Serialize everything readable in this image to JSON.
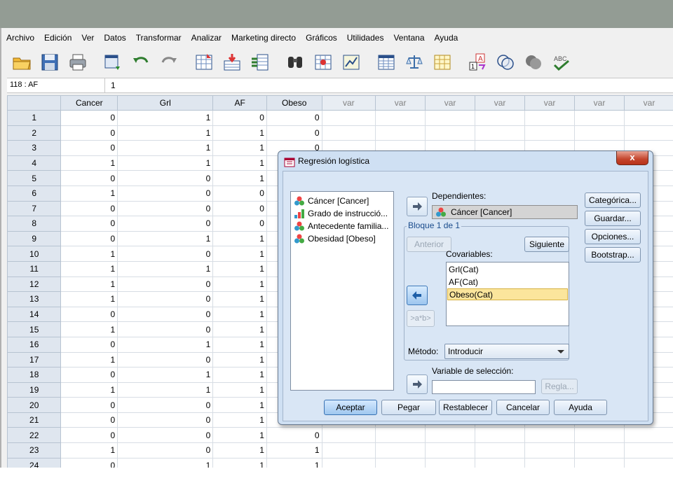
{
  "menu": [
    "Archivo",
    "Edición",
    "Ver",
    "Datos",
    "Transformar",
    "Analizar",
    "Marketing directo",
    "Gráficos",
    "Utilidades",
    "Ventana",
    "Ayuda"
  ],
  "cell_editor": {
    "ref": "118 : AF",
    "value": "1"
  },
  "grid": {
    "columns": [
      "Cancer",
      "Grl",
      "AF",
      "Obeso",
      "var",
      "var",
      "var",
      "var",
      "var",
      "var",
      "var"
    ],
    "rows": [
      {
        "n": "1",
        "c": [
          "0",
          "1",
          "0",
          "0"
        ]
      },
      {
        "n": "2",
        "c": [
          "0",
          "1",
          "1",
          "0"
        ]
      },
      {
        "n": "3",
        "c": [
          "0",
          "1",
          "1",
          "0"
        ]
      },
      {
        "n": "4",
        "c": [
          "1",
          "1",
          "1",
          ""
        ]
      },
      {
        "n": "5",
        "c": [
          "0",
          "0",
          "1",
          ""
        ]
      },
      {
        "n": "6",
        "c": [
          "1",
          "0",
          "0",
          ""
        ]
      },
      {
        "n": "7",
        "c": [
          "0",
          "0",
          "0",
          ""
        ]
      },
      {
        "n": "8",
        "c": [
          "0",
          "0",
          "0",
          ""
        ]
      },
      {
        "n": "9",
        "c": [
          "0",
          "1",
          "1",
          ""
        ]
      },
      {
        "n": "10",
        "c": [
          "1",
          "0",
          "1",
          ""
        ]
      },
      {
        "n": "11",
        "c": [
          "1",
          "1",
          "1",
          ""
        ]
      },
      {
        "n": "12",
        "c": [
          "1",
          "0",
          "1",
          ""
        ]
      },
      {
        "n": "13",
        "c": [
          "1",
          "0",
          "1",
          ""
        ]
      },
      {
        "n": "14",
        "c": [
          "0",
          "0",
          "1",
          ""
        ]
      },
      {
        "n": "15",
        "c": [
          "1",
          "0",
          "1",
          ""
        ]
      },
      {
        "n": "16",
        "c": [
          "0",
          "1",
          "1",
          ""
        ]
      },
      {
        "n": "17",
        "c": [
          "1",
          "0",
          "1",
          ""
        ]
      },
      {
        "n": "18",
        "c": [
          "0",
          "1",
          "1",
          ""
        ]
      },
      {
        "n": "19",
        "c": [
          "1",
          "1",
          "1",
          ""
        ]
      },
      {
        "n": "20",
        "c": [
          "0",
          "0",
          "1",
          ""
        ]
      },
      {
        "n": "21",
        "c": [
          "0",
          "0",
          "1",
          ""
        ]
      },
      {
        "n": "22",
        "c": [
          "0",
          "0",
          "1",
          "0"
        ]
      },
      {
        "n": "23",
        "c": [
          "1",
          "0",
          "1",
          "1"
        ]
      },
      {
        "n": "24",
        "c": [
          "0",
          "1",
          "1",
          "1"
        ]
      }
    ]
  },
  "dialog": {
    "title": "Regresión logística",
    "close": "x",
    "variables": [
      {
        "label": "Cáncer [Cancer]",
        "icon": "nominal-icon"
      },
      {
        "label": "Grado de instrucció...",
        "icon": "ordinal-icon"
      },
      {
        "label": "Antecedente familia...",
        "icon": "nominal-icon"
      },
      {
        "label": "Obesidad [Obeso]",
        "icon": "nominal-icon"
      }
    ],
    "dependent_label": "Dependientes:",
    "dependent_value": "Cáncer [Cancer]",
    "block_label": "Bloque 1 de 1",
    "prev_button": "Anterior",
    "next_button": "Siguiente",
    "covariates_label": "Covariables:",
    "covariates": [
      "Grl(Cat)",
      "AF(Cat)",
      "Obeso(Cat)"
    ],
    "interaction_button": ">a*b>",
    "method_label": "Método:",
    "method_value": "Introducir",
    "selection_label": "Variable de selección:",
    "rule_button": "Regla...",
    "side_buttons": [
      "Categórica...",
      "Guardar...",
      "Opciones...",
      "Bootstrap..."
    ],
    "bottom_buttons": [
      "Aceptar",
      "Pegar",
      "Restablecer",
      "Cancelar",
      "Ayuda"
    ]
  }
}
